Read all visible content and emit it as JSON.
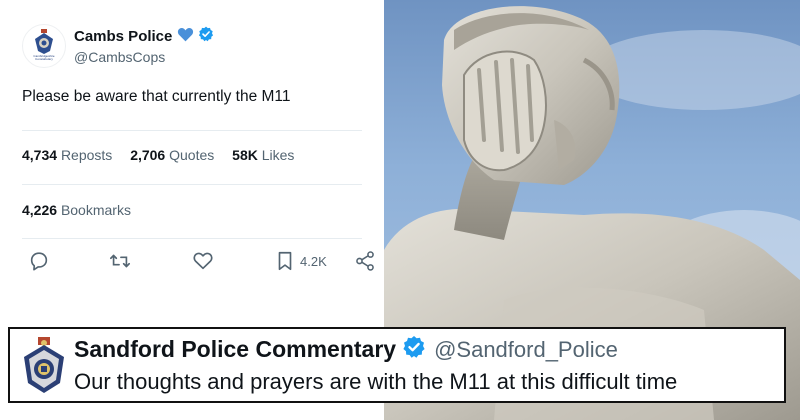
{
  "tweet": {
    "avatar_icon": "police-crest-icon",
    "avatar_caption": "Cambridgeshire Constabulary",
    "display_name": "Cambs Police",
    "handle": "@CambsCops",
    "text": "Please be aware that currently the M11",
    "stats": {
      "reposts_count": "4,734",
      "reposts_label": "Reposts",
      "quotes_count": "2,706",
      "quotes_label": "Quotes",
      "likes_count": "58K",
      "likes_label": "Likes",
      "bookmarks_count": "4,226",
      "bookmarks_label": "Bookmarks"
    },
    "actions": {
      "reply_icon": "reply-icon",
      "repost_icon": "repost-icon",
      "like_icon": "heart-icon",
      "bookmark_icon": "bookmark-icon",
      "bookmark_count": "4.2K",
      "share_icon": "share-icon"
    }
  },
  "photo": {
    "description_icon": "facepalm-statue-image"
  },
  "overlay": {
    "badge_icon": "police-badge-icon",
    "display_name": "Sandford Police Commentary",
    "handle": "@Sandford_Police",
    "text": "Our thoughts and prayers are with the M11 at this difficult time"
  },
  "colors": {
    "verified_blue": "#1d9bf0",
    "heart_blue": "#4a90d9",
    "text_primary": "#0f1419",
    "text_secondary": "#536471",
    "sky": "#8eb0d8"
  }
}
